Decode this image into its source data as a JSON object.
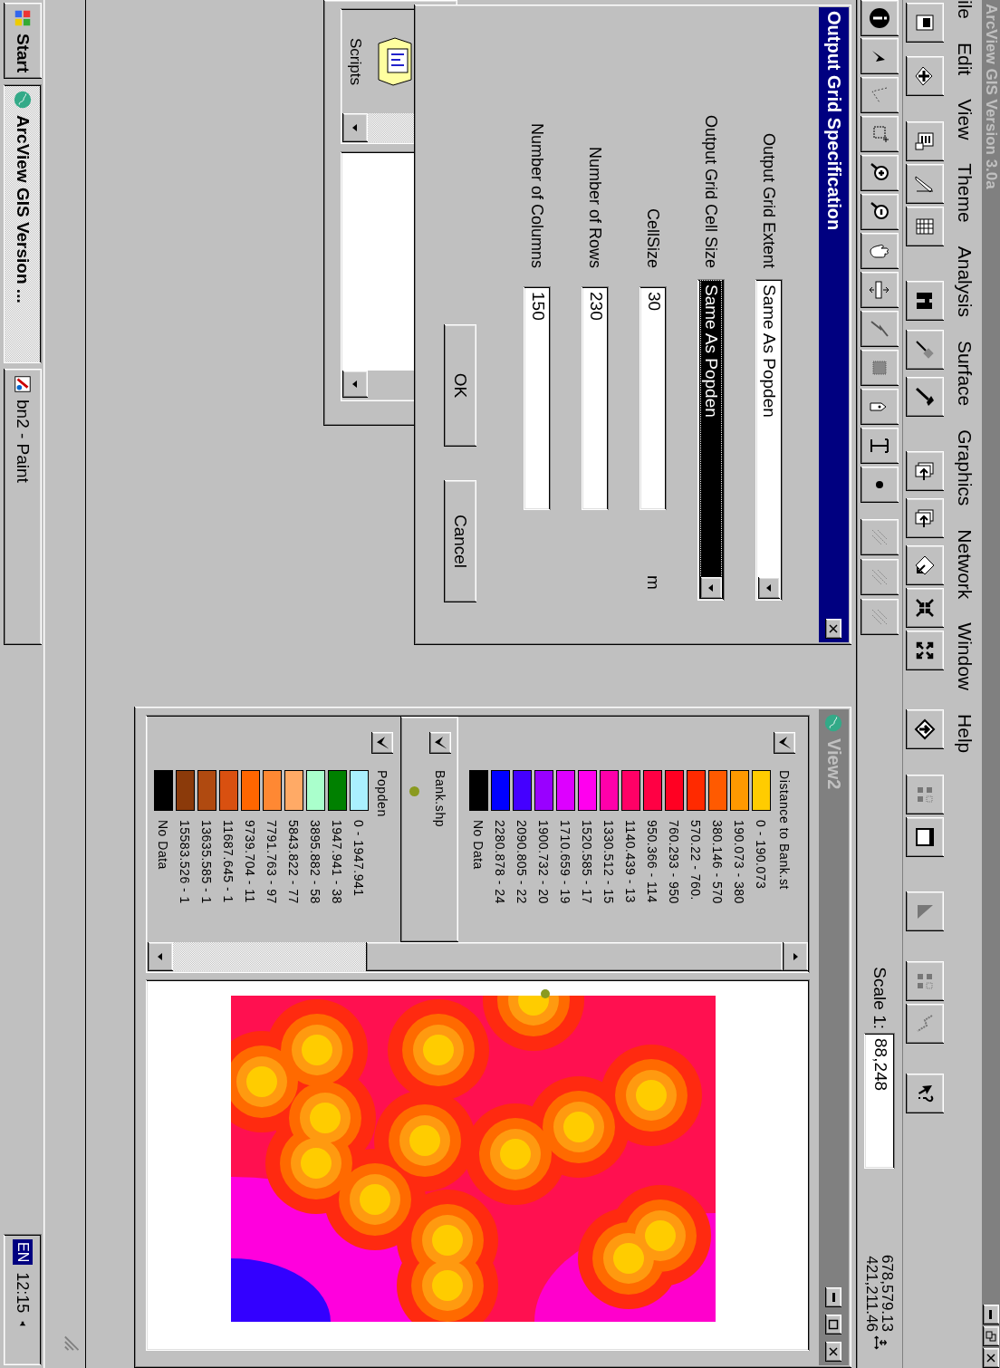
{
  "app": {
    "title": "ArcView GIS Version 3.0a",
    "active": false
  },
  "menu": [
    "ile",
    "Edit",
    "View",
    "Theme",
    "Analysis",
    "Surface",
    "Graphics",
    "Network",
    "Window",
    "Help"
  ],
  "toolbar": {
    "scale_label": "Scale 1:",
    "scale": "88,248",
    "x_coord": "678,579.13",
    "y_coord": "421,211.46"
  },
  "dialog": {
    "title": "Output Grid Specification",
    "fields": [
      {
        "kind": "combo",
        "label": "Output Grid Extent",
        "value": "Same As Popden",
        "focused": false
      },
      {
        "kind": "combo",
        "label": "Output Grid Cell Size",
        "value": "Same As Popden",
        "focused": true
      },
      {
        "kind": "text",
        "label": "CellSize",
        "value": "30",
        "unit": "m"
      },
      {
        "kind": "text",
        "label": "Number of Rows",
        "value": "230"
      },
      {
        "kind": "text",
        "label": "Number of Columns",
        "value": "150"
      }
    ],
    "buttons": [
      "OK",
      "Cancel"
    ]
  },
  "project": {
    "items": [
      {
        "label": "Scripts"
      }
    ]
  },
  "view": {
    "title": "View2",
    "active": false,
    "themes": [
      {
        "kind": "ranges",
        "name": "Distance to Bank.st",
        "visible": true,
        "selected": false,
        "classes": [
          {
            "label": "0 - 190.073",
            "color": "#ffcc00"
          },
          {
            "label": "190.073 - 380",
            "color": "#ff9900"
          },
          {
            "label": "380.146 - 570",
            "color": "#ff5a00"
          },
          {
            "label": "570.22 - 760.",
            "color": "#ff2a00"
          },
          {
            "label": "760.293 - 950",
            "color": "#ff0022"
          },
          {
            "label": "950.366 - 114",
            "color": "#ff0044"
          },
          {
            "label": "1140.439 - 13",
            "color": "#ff0066"
          },
          {
            "label": "1330.512 - 15",
            "color": "#ff00aa"
          },
          {
            "label": "1520.585 - 17",
            "color": "#ff00ee"
          },
          {
            "label": "1710.659 - 19",
            "color": "#dd00ff"
          },
          {
            "label": "1900.732 - 20",
            "color": "#9900ff"
          },
          {
            "label": "2090.805 - 22",
            "color": "#4400ff"
          },
          {
            "label": "2280.878 - 24",
            "color": "#0000ff"
          },
          {
            "label": "No Data",
            "color": "#000000"
          }
        ]
      },
      {
        "kind": "point",
        "name": "Bank.shp",
        "visible": true,
        "selected": true,
        "color": "#8a9a20"
      },
      {
        "kind": "ranges",
        "name": "Popden",
        "visible": true,
        "selected": false,
        "classes": [
          {
            "label": "0 - 1947.941",
            "color": "#aaf0ff"
          },
          {
            "label": "1947.941 - 38",
            "color": "#008000"
          },
          {
            "label": "3895.882 - 58",
            "color": "#aaffcc"
          },
          {
            "label": "5843.822 - 77",
            "color": "#ffaa66"
          },
          {
            "label": "7791.763 - 97",
            "color": "#ff8833"
          },
          {
            "label": "9739.704 - 11",
            "color": "#ff6600"
          },
          {
            "label": "11687.645 - 1",
            "color": "#d95010"
          },
          {
            "label": "13635.585 - 1",
            "color": "#b04a10"
          },
          {
            "label": "15583.526 - 1",
            "color": "#8b3a0a"
          },
          {
            "label": "No Data",
            "color": "#000000"
          }
        ]
      }
    ]
  },
  "taskbar": {
    "start": "Start",
    "tasks": [
      {
        "label": "ArcView GIS Version ...",
        "selected": true
      },
      {
        "label": "bn2 - Paint",
        "selected": false
      }
    ],
    "language": "EN",
    "clock": "12:15"
  }
}
